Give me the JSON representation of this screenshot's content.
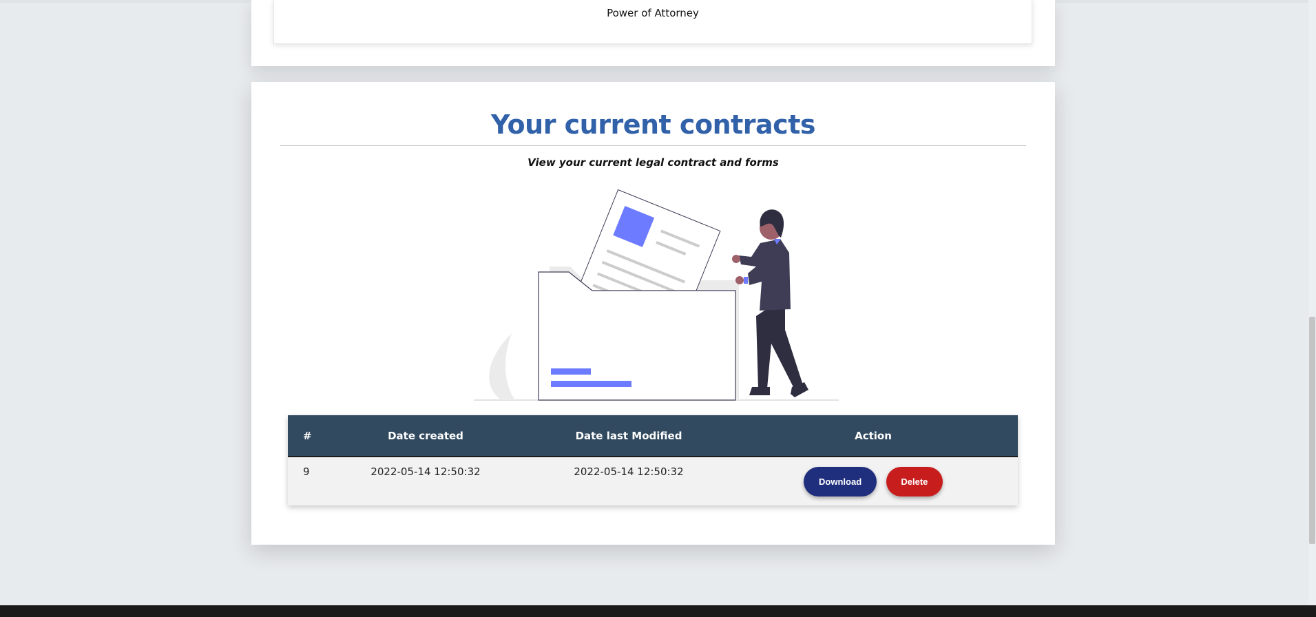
{
  "previous_card": {
    "label": "Power of Attorney"
  },
  "contracts_section": {
    "title": "Your current contracts",
    "subtitle": "View your current legal contract and forms",
    "illustration": "person-filing-documents-icon",
    "table": {
      "headers": [
        "#",
        "Date created",
        "Date last Modified",
        "Action"
      ],
      "rows": [
        {
          "id": "9",
          "date_created": "2022-05-14 12:50:32",
          "date_modified": "2022-05-14 12:50:32",
          "download_label": "Download",
          "delete_label": "Delete"
        }
      ]
    }
  },
  "colors": {
    "title": "#3161a8",
    "table_header": "#324a5f",
    "download_button": "#1f2f7e",
    "delete_button": "#c81d1d",
    "accent_illustration": "#6c7bff"
  }
}
